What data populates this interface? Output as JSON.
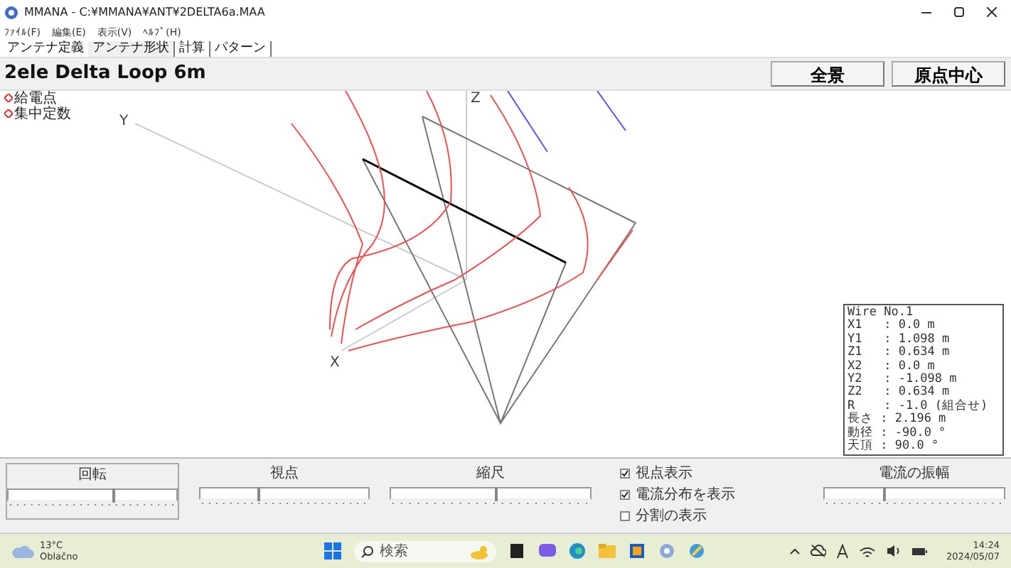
{
  "window": {
    "title": "MMANA - C:¥MMANA¥ANT¥2DELTA6a.MAA"
  },
  "menu": [
    "ﾌｧｲﾙ(F)",
    "編集(E)",
    "表示(V)",
    "ﾍﾙﾌﾟ(H)"
  ],
  "tabs": [
    {
      "label": "アンテナ定義",
      "selected": false
    },
    {
      "label": "アンテナ形状",
      "selected": true
    },
    {
      "label": "計算",
      "selected": false
    },
    {
      "label": "パターン",
      "selected": false
    }
  ],
  "header": {
    "title": "2ele Delta Loop 6m",
    "buttons": [
      "全景",
      "原点中心"
    ]
  },
  "view": {
    "legend": [
      "給電点",
      "集中定数"
    ],
    "axes": [
      "Z",
      "Y",
      "X"
    ],
    "info": [
      "Wire No.1",
      "X1   : 0.0 m",
      "Y1   : 1.098 m",
      "Z1   : 0.634 m",
      "X2   : 0.0 m",
      "Y2   : -1.098 m",
      "Z2   : 0.634 m",
      "R    : -1.0 (組合せ)",
      "長さ : 2.196 m",
      "動径 : -90.0 °",
      "天頂 : 90.0 °"
    ]
  },
  "controls": {
    "sliders": [
      {
        "label": "回転",
        "level": 0.63
      },
      {
        "label": "視点",
        "level": 0.35
      },
      {
        "label": "縮尺",
        "level": 0.53
      }
    ],
    "checkboxes": [
      {
        "label": "視点表示",
        "checked": true
      },
      {
        "label": "電流分布を表示",
        "checked": true
      },
      {
        "label": "分割の表示",
        "checked": false
      }
    ],
    "amplitude": {
      "label": "電流の振幅",
      "level": 0.33
    }
  },
  "taskbar": {
    "weather": {
      "temperature": "13°C",
      "condition": "Oblačno"
    },
    "search": {
      "placeholder": "検索"
    },
    "clock": {
      "time": "14:24",
      "date": "2024/05/07"
    }
  }
}
